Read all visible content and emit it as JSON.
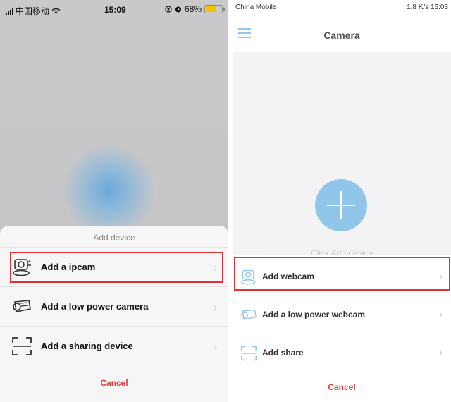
{
  "left": {
    "status": {
      "carrier": "中国移动",
      "time": "15:09",
      "battery_percent": "68%",
      "battery_level": 0.68
    },
    "sheet": {
      "title": "Add device",
      "items": [
        {
          "label": "Add a ipcam",
          "icon": "ipcam-icon"
        },
        {
          "label": "Add a low power camera",
          "icon": "low-power-camera-icon"
        },
        {
          "label": "Add a sharing device",
          "icon": "scan-frame-icon"
        }
      ],
      "cancel": "Cancel"
    }
  },
  "right": {
    "status": {
      "carrier": "China Mobile",
      "right_text": "1.8 K/s 16:03"
    },
    "header": {
      "title": "Camera"
    },
    "body": {
      "hint": "Click Add device"
    },
    "list": {
      "items": [
        {
          "label": "Add webcam",
          "icon": "ipcam-icon"
        },
        {
          "label": "Add a low power webcam",
          "icon": "low-power-camera-icon"
        },
        {
          "label": "Add share",
          "icon": "scan-frame-icon"
        }
      ],
      "cancel": "Cancel"
    }
  },
  "colors": {
    "accent_blue": "#8fc6ea",
    "highlight_red": "#e0303a",
    "cancel_red": "#e63a3a"
  }
}
